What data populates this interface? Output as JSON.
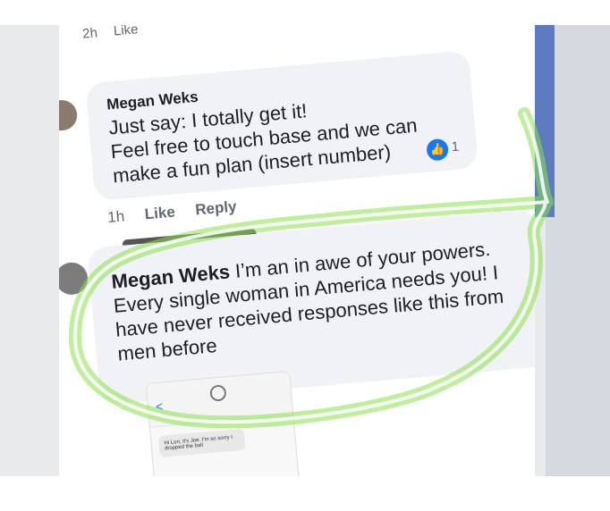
{
  "thread": {
    "prev_time": "2h",
    "prev_like": "Like",
    "comment1": {
      "author": "Megan Weks",
      "lines": [
        "Just say: I totally get it!",
        "Feel free to touch base and we can",
        "make a fun plan (insert number)"
      ],
      "reaction_count": "1",
      "time": "1h",
      "like_label": "Like",
      "reply_label": "Reply"
    },
    "comment2": {
      "author": "Megan Weks",
      "text": "I’m an in awe of your powers. Every single woman in America needs you! I have never received responses like this from men before"
    },
    "attachment": {
      "back_symbol": "<",
      "snippet": "Hi Lori, it's Joe. I'm so sorry I dropped the ball"
    }
  },
  "colors": {
    "highlight_stroke": "#8be04e",
    "bubble_bg": "#f0f2f5",
    "facebook_blue": "#1877f2"
  },
  "icons": {
    "reaction": "thumbs-up-icon",
    "avatar1": "avatar",
    "avatar2": "avatar"
  }
}
